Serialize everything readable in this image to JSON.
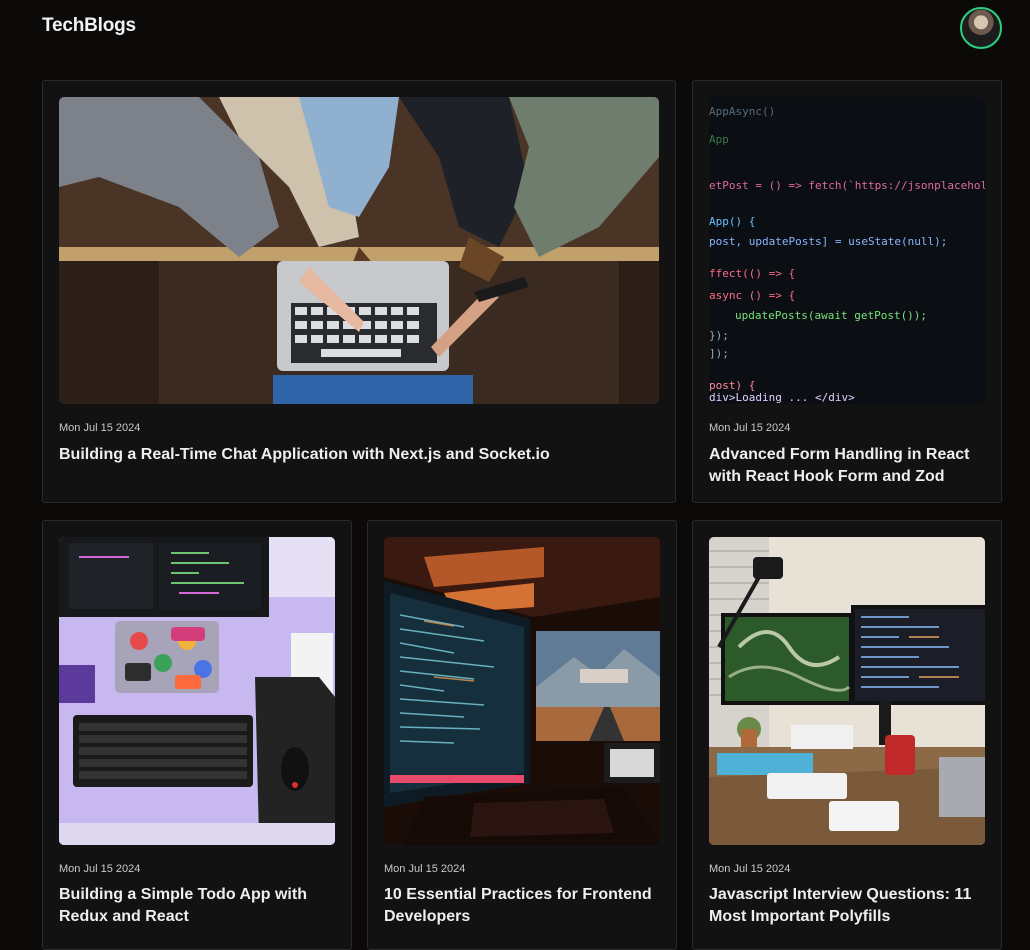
{
  "header": {
    "brand": "TechBlogs"
  },
  "posts": [
    {
      "date": "Mon Jul 15 2024",
      "title": "Building a Real-Time Chat Application with Next.js and Socket.io",
      "image": "laptop-teamwork-photo"
    },
    {
      "date": "Mon Jul 15 2024",
      "title": "Advanced Form Handling in React with React Hook Form and Zod",
      "image": "react-code-screen-photo",
      "code_lines": [
        "AppAsync()",
        "App",
        "etPost = () => fetch(`https://jsonplaceholder.",
        "App() {",
        "post, updatePosts] = useState(null);",
        "ffect(() => {",
        "async () => {",
        "updatePosts(await getPost());",
        "});",
        "]);",
        "post) {",
        "div>Loading ... </div>"
      ]
    },
    {
      "date": "Mon Jul 15 2024",
      "title": "Building a Simple Todo App with Redux and React",
      "image": "desk-keyboard-stickers-photo"
    },
    {
      "date": "Mon Jul 15 2024",
      "title": "10 Essential Practices for Frontend Developers",
      "image": "dual-monitor-dark-setup-photo"
    },
    {
      "date": "Mon Jul 15 2024",
      "title": "Javascript Interview Questions: 11 Most Important Polyfills",
      "image": "workspace-monitors-photo"
    }
  ]
}
